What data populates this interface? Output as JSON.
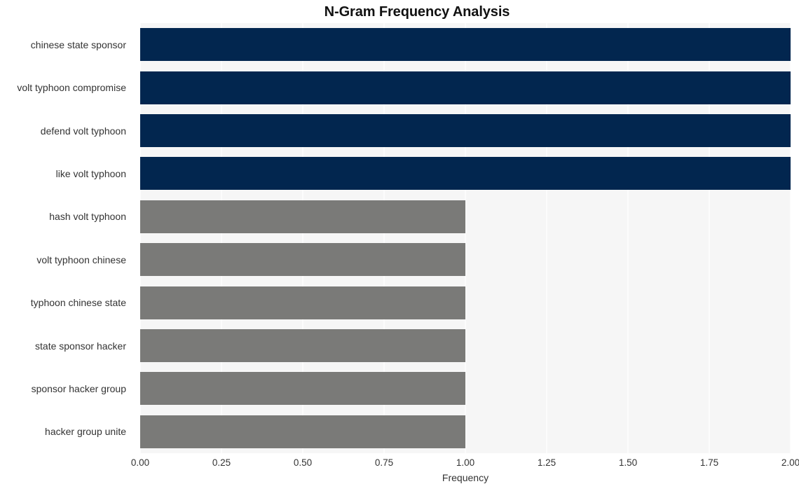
{
  "chart_data": {
    "type": "bar",
    "orientation": "horizontal",
    "title": "N-Gram Frequency Analysis",
    "xlabel": "Frequency",
    "ylabel": "",
    "categories": [
      "chinese state sponsor",
      "volt typhoon compromise",
      "defend volt typhoon",
      "like volt typhoon",
      "hash volt typhoon",
      "volt typhoon chinese",
      "typhoon chinese state",
      "state sponsor hacker",
      "sponsor hacker group",
      "hacker group unite"
    ],
    "values": [
      2,
      2,
      2,
      2,
      1,
      1,
      1,
      1,
      1,
      1
    ],
    "bar_colors": [
      "#02264f",
      "#02264f",
      "#02264f",
      "#02264f",
      "#7a7a78",
      "#7a7a78",
      "#7a7a78",
      "#7a7a78",
      "#7a7a78",
      "#7a7a78"
    ],
    "xlim": [
      0.0,
      2.0
    ],
    "xticks": [
      0.0,
      0.25,
      0.5,
      0.75,
      1.0,
      1.25,
      1.5,
      1.75,
      2.0
    ],
    "xtick_labels": [
      "0.00",
      "0.25",
      "0.50",
      "0.75",
      "1.00",
      "1.25",
      "1.50",
      "1.75",
      "2.00"
    ],
    "grid": true,
    "grid_color": "#fcfcfc",
    "legend": null,
    "plot_background": "#f6f6f6",
    "figure_background": "#ffffff",
    "colors": {
      "high": "#02264f",
      "low": "#7a7a78",
      "text": "#333333",
      "title": "#111111"
    }
  }
}
